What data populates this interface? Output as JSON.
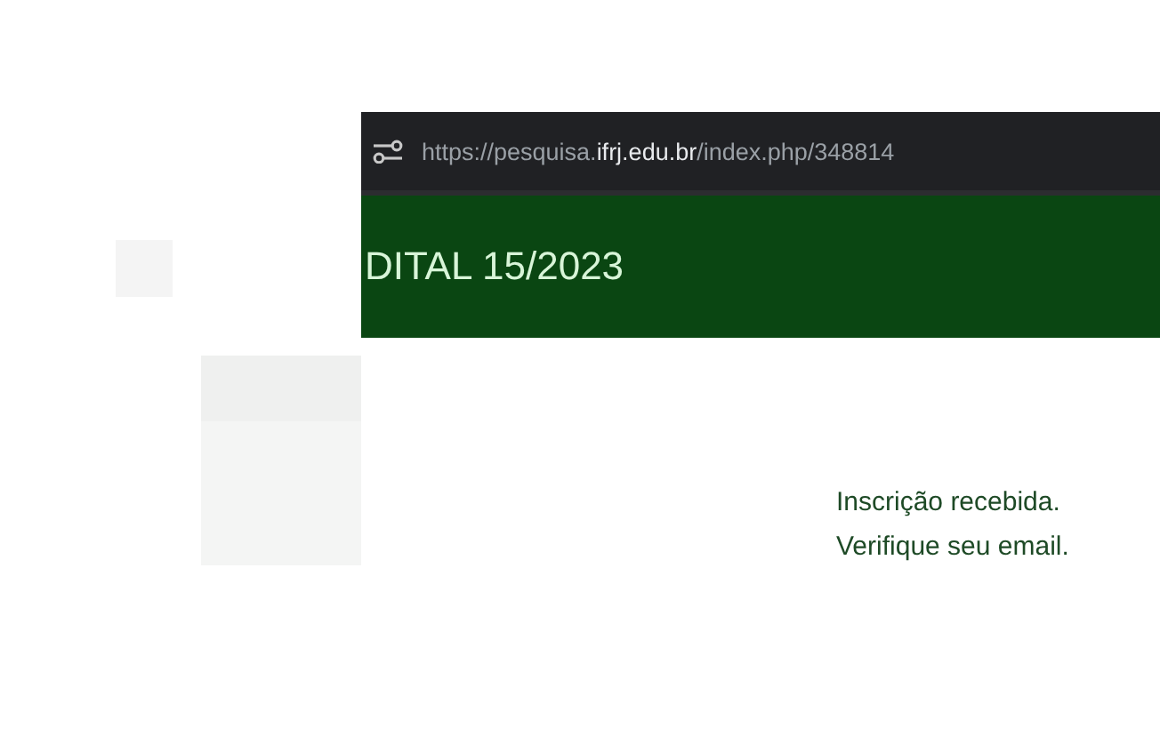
{
  "popup": {
    "url": {
      "prefix": "https://pesquisa.",
      "domain": "ifrj.edu.br",
      "path": "/index.php/348814"
    },
    "header_title": "DITAL 15/2023",
    "message_lines": [
      "Inscrição recebida.",
      "Verifique seu email."
    ]
  }
}
